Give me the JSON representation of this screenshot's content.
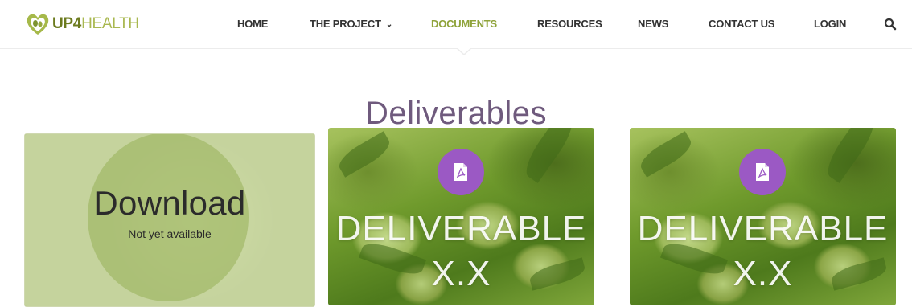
{
  "brand": {
    "logo_bold": "UP4",
    "logo_light": "HEALTH",
    "colors": {
      "green": "#8fa33a",
      "purple": "#6f5a7d",
      "badge": "#9b59c4"
    }
  },
  "nav": {
    "items": [
      {
        "label": "HOME"
      },
      {
        "label": "THE PROJECT",
        "has_dropdown": true
      },
      {
        "label": "DOCUMENTS",
        "active": true
      },
      {
        "label": "RESOURCES"
      },
      {
        "label": "NEWS"
      },
      {
        "label": "CONTACT US"
      },
      {
        "label": "LOGIN"
      }
    ],
    "dropdown_icon": "chevron-down-icon",
    "search_icon": "search-icon"
  },
  "page": {
    "title": "Deliverables"
  },
  "cards": [
    {
      "state": "unavailable",
      "title": "Download",
      "subtitle": "Not yet available"
    },
    {
      "state": "available",
      "icon": "pdf-file-icon",
      "title_line1": "DELIVERABLE",
      "title_line2": "X.X"
    },
    {
      "state": "available",
      "icon": "pdf-file-icon",
      "title_line1": "DELIVERABLE",
      "title_line2": "X.X"
    }
  ]
}
